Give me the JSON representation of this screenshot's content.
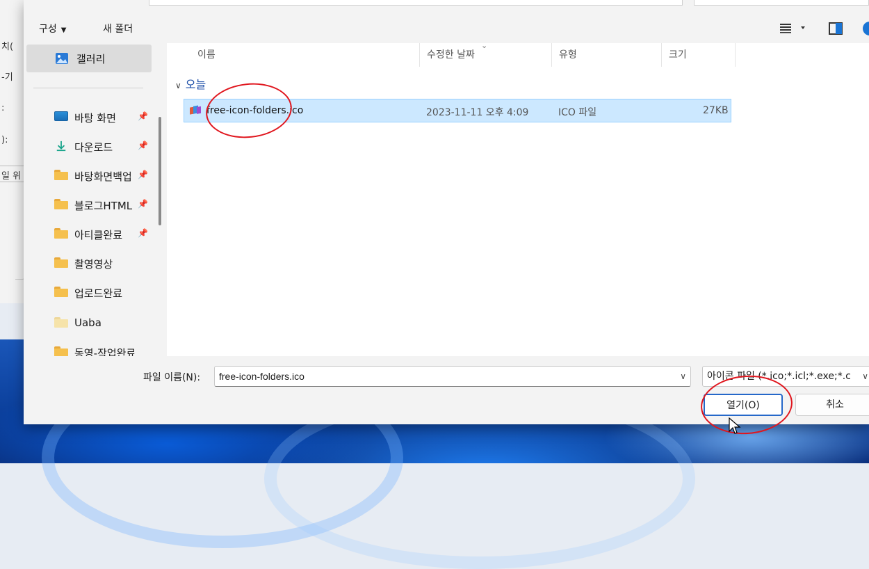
{
  "behind_window": {
    "fragments": [
      "치(",
      "-기",
      ":",
      "):",
      "일 위"
    ]
  },
  "toolbar": {
    "organize_label": "구성",
    "new_folder_label": "새 폴더",
    "icons": {
      "view": "view-options-icon",
      "preview_pane": "preview-pane-icon",
      "help": "help-icon"
    }
  },
  "nav": {
    "gallery_label": "갤러리",
    "items": [
      {
        "label": "바탕 화면",
        "icon": "desktop-icon",
        "pinned": true
      },
      {
        "label": "다운로드",
        "icon": "download-icon",
        "pinned": true
      },
      {
        "label": "바탕화면백업",
        "icon": "folder-icon",
        "pinned": true
      },
      {
        "label": "블로그HTML",
        "icon": "folder-icon",
        "pinned": true
      },
      {
        "label": "아티클완료",
        "icon": "folder-icon",
        "pinned": true
      },
      {
        "label": "촬영영상",
        "icon": "folder-icon",
        "pinned": false
      },
      {
        "label": "업로드완료",
        "icon": "folder-icon",
        "pinned": false
      },
      {
        "label": "Uaba",
        "icon": "folder-icon",
        "pinned": false
      },
      {
        "label": "동영-작업완료",
        "icon": "folder-icon",
        "pinned": false
      }
    ]
  },
  "columns": {
    "name": "이름",
    "date": "수정한 날짜",
    "type": "유형",
    "size": "크기"
  },
  "group_label": "오늘",
  "files": [
    {
      "name": "free-icon-folders.ico",
      "date": "2023-11-11 오후 4:09",
      "type": "ICO 파일",
      "size": "27KB",
      "selected": true
    }
  ],
  "footer": {
    "filename_label": "파일 이름(N):",
    "filename_value": "free-icon-folders.ico",
    "filter_value": "아이콘 파일 (*.ico;*.icl;*.exe;*.c",
    "open_label": "열기(O)",
    "cancel_label": "취소"
  },
  "colors": {
    "selection": "#cce8ff",
    "accent": "#2568c9",
    "annotation": "#e0161e"
  }
}
